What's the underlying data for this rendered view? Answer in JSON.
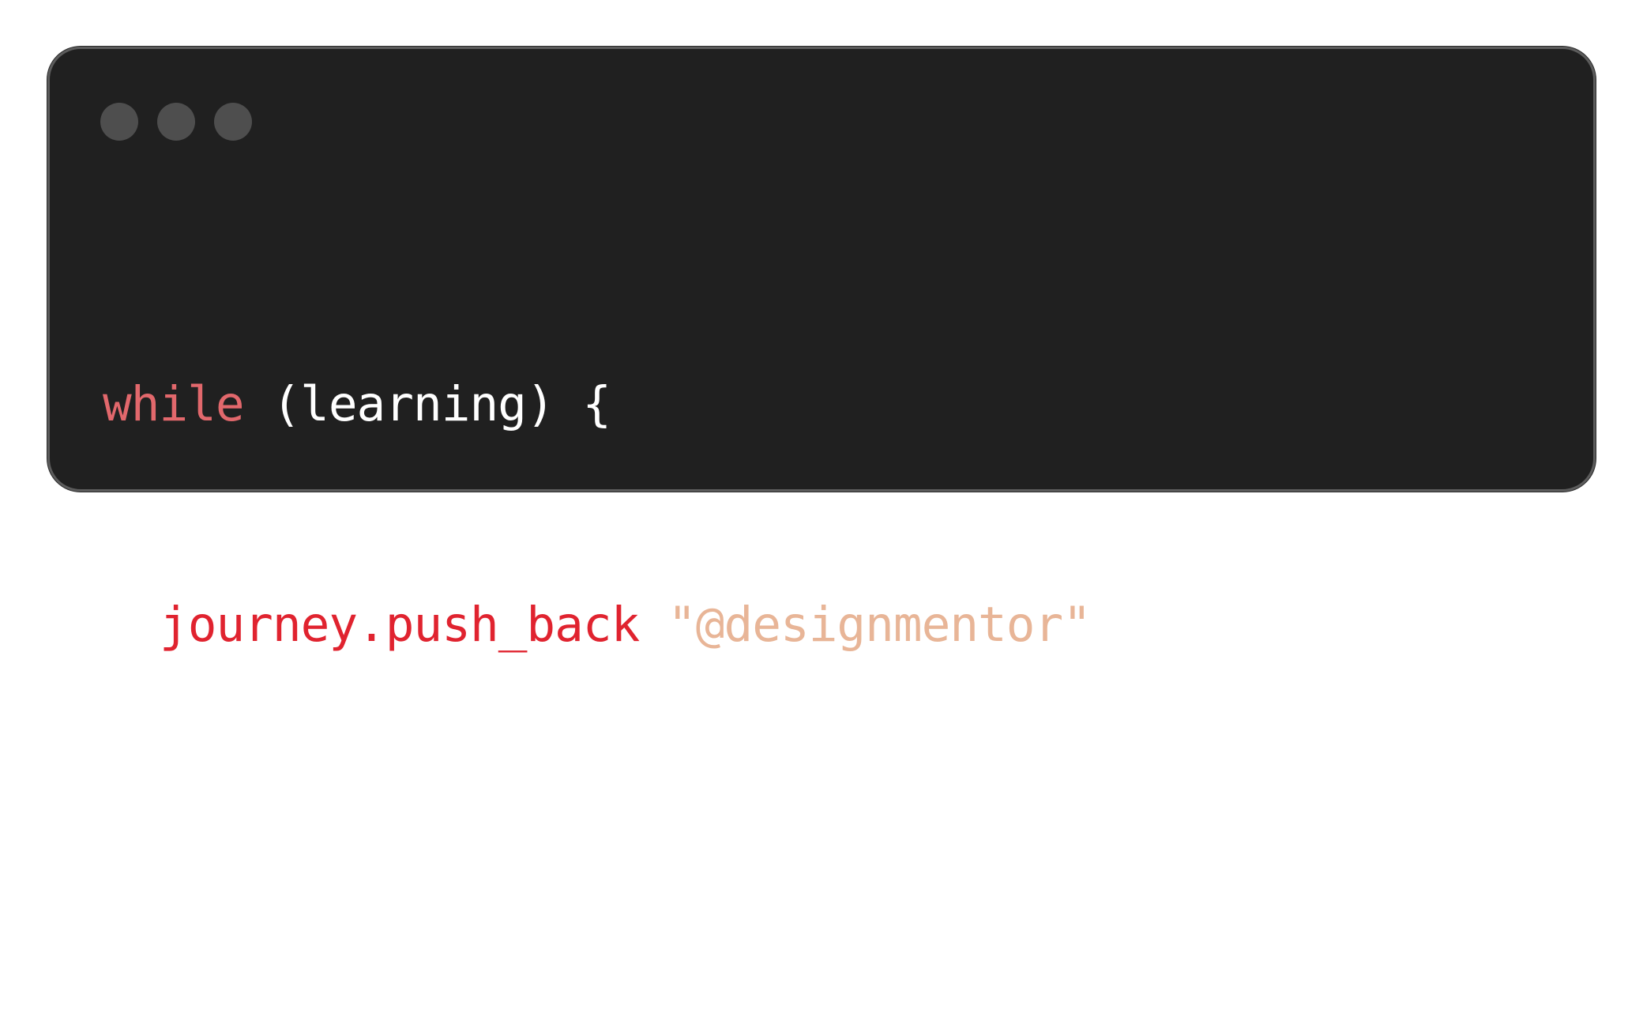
{
  "window": {
    "controls": [
      {
        "name": "close",
        "color": "#4e4e4e"
      },
      {
        "name": "minimize",
        "color": "#4e4e4e"
      },
      {
        "name": "maximize",
        "color": "#4e4e4e"
      }
    ]
  },
  "code": {
    "line1": {
      "keyword": "while",
      "space1": " ",
      "condition": "(learning)",
      "space2": " ",
      "open_brace": "{"
    },
    "line2": {
      "call": "journey.push_back",
      "open_paren": "(",
      "string": "\"@designmentor\"",
      "close": ");"
    },
    "line3": {
      "close_brace": "}"
    }
  },
  "colors": {
    "background": "#202020",
    "keyword": "#e2686c",
    "function": "#e0232f",
    "string": "#e8b597",
    "punctuation": "#ffffff"
  }
}
